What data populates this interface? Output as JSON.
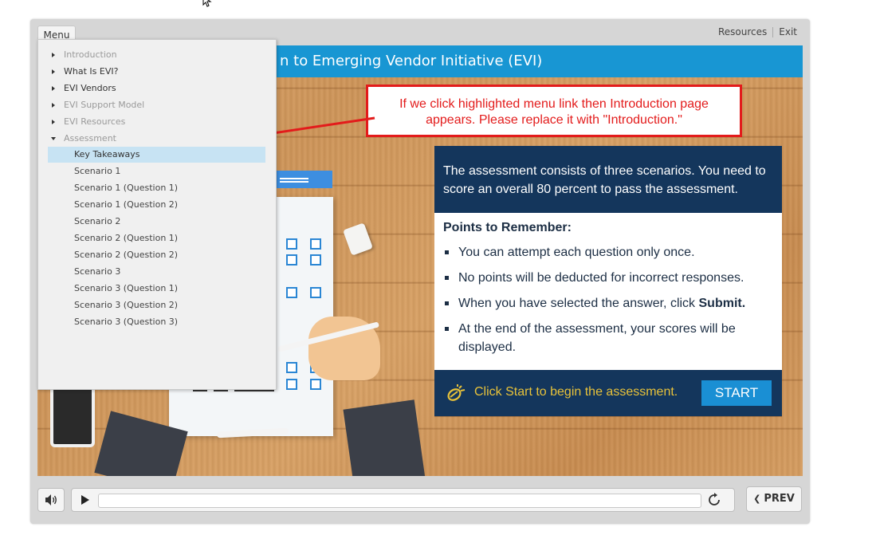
{
  "player": {
    "menu_tab": "Menu",
    "resources_label": "Resources",
    "exit_label": "Exit"
  },
  "slide": {
    "title": "n to Emerging Vendor Initiative (EVI)"
  },
  "menu": {
    "items": [
      {
        "label": "Introduction",
        "state": "collapsed",
        "style": "disabled"
      },
      {
        "label": "What Is EVI?",
        "state": "collapsed",
        "style": "normal"
      },
      {
        "label": "EVI Vendors",
        "state": "collapsed",
        "style": "normal"
      },
      {
        "label": "EVI Support Model",
        "state": "collapsed",
        "style": "disabled"
      },
      {
        "label": "EVI Resources",
        "state": "collapsed",
        "style": "disabled"
      },
      {
        "label": "Assessment",
        "state": "expanded",
        "style": "disabled"
      }
    ],
    "assessment_children": [
      {
        "label": "Key Takeaways",
        "selected": true
      },
      {
        "label": "Scenario 1"
      },
      {
        "label": "Scenario 1 (Question 1)"
      },
      {
        "label": "Scenario 1 (Question 2)"
      },
      {
        "label": "Scenario 2"
      },
      {
        "label": "Scenario 2 (Question 1)"
      },
      {
        "label": "Scenario 2 (Question 2)"
      },
      {
        "label": "Scenario 3"
      },
      {
        "label": "Scenario 3 (Question 1)"
      },
      {
        "label": "Scenario 3 (Question 2)"
      },
      {
        "label": "Scenario 3 (Question 3)"
      }
    ]
  },
  "callout": {
    "line1": "If we click highlighted menu link then Introduction page",
    "line2": "appears. Please replace it with \"Introduction.\"",
    "color": "#e31b1b"
  },
  "assessment": {
    "intro": "The assessment consists of three scenarios. You need to score an overall 80 percent to pass the assessment.",
    "points_heading": "Points to Remember:",
    "bullets": [
      "You can attempt each question only once.",
      "No points will be deducted for incorrect responses.",
      "When you have selected the answer, click ",
      "At the end of the assessment, your scores will be displayed."
    ],
    "submit_word": "Submit.",
    "footer_text": "Click Start to begin the assessment.",
    "start_label": "START"
  },
  "controls": {
    "prev_label": "PREV",
    "volume_icon": "speaker-icon",
    "play_icon": "play-icon",
    "replay_icon": "replay-icon"
  },
  "colors": {
    "title_bar": "#1896d3",
    "panel_navy": "#14365c",
    "accent_yellow": "#e8c23a",
    "start_blue": "#1a8fd4",
    "menu_selected": "#c7e3f3"
  }
}
